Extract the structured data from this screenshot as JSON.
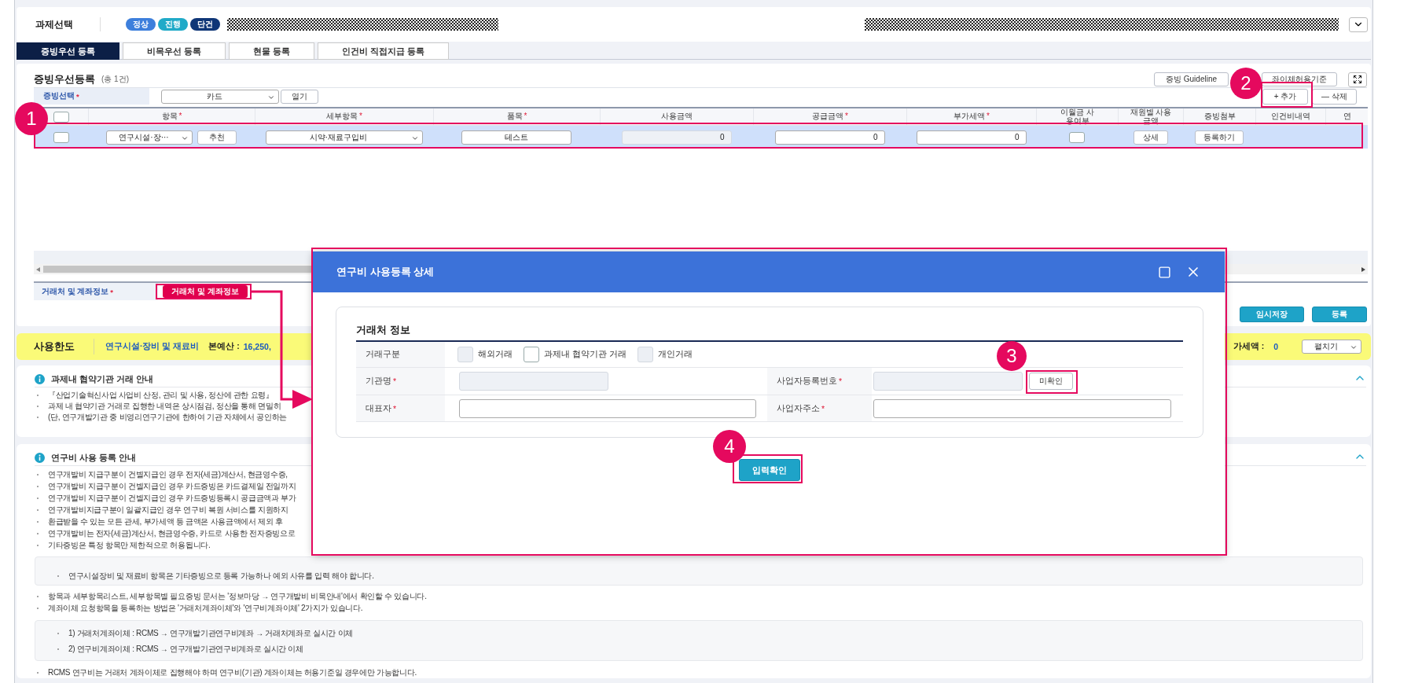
{
  "top_bar": {
    "title": "과제선택",
    "badges": [
      {
        "label": "정상",
        "color": "#3d7fdc"
      },
      {
        "label": "진행",
        "color": "#20aac8"
      },
      {
        "label": "단건",
        "color": "#0f3677"
      }
    ]
  },
  "tabs": [
    {
      "label": "증빙우선 등록",
      "selected": true
    },
    {
      "label": "비목우선 등록",
      "selected": false
    },
    {
      "label": "현물 등록",
      "selected": false
    },
    {
      "label": "인건비 직접지급 등록",
      "selected": false
    }
  ],
  "register": {
    "title": "증빙우선등록",
    "count": "(총 1건)",
    "guide_buttons": [
      "증빙 Guideline",
      "좌이체허용기준"
    ],
    "filter": {
      "label": "증빙선택",
      "mark": "*",
      "value": "카드",
      "button": "열기"
    },
    "row_buttons": [
      "+ 추가",
      "— 삭제"
    ],
    "header_checked": false,
    "columns": [
      {
        "label": "항목",
        "mark": "*"
      },
      {
        "label": "세부항목",
        "mark": "*"
      },
      {
        "label": "품목",
        "mark": "*"
      },
      {
        "label": "사용금액"
      },
      {
        "label": "공급금액",
        "mark": "*"
      },
      {
        "label": "부가세액",
        "mark": "*"
      },
      {
        "label": "이월금 사용여부"
      },
      {
        "label": "재원별 사용금액"
      },
      {
        "label": "증빙첨부"
      },
      {
        "label": "인건비내역"
      },
      {
        "label": "연"
      }
    ],
    "rows": [
      {
        "selected": true,
        "checked": false,
        "item": "연구시설·장···",
        "recommend": "추천",
        "sub_item": "시약·재료구입비",
        "product": {
          "value": "테스트",
          "disabled": false
        },
        "usage_amount": {
          "value": "0",
          "disabled": true
        },
        "supply_amount": {
          "value": "0",
          "disabled": false
        },
        "vat": {
          "value": "0",
          "disabled": false
        },
        "carryover_checked": false,
        "detail": "상세",
        "attach": "등록하기"
      }
    ],
    "footer": {
      "label": "거래처 및 계좌정보",
      "mark": "*",
      "button": "거래처 및 계좌정보"
    },
    "actions": [
      "임시저장",
      "등록"
    ]
  },
  "limit_bar": {
    "title": "사용한도",
    "category": "연구시설·장비 및 재료비",
    "budget_label": "본예산 :",
    "budget_value": "16,250,",
    "vat_label": "가세액 :",
    "vat_value": "0",
    "toggle": "펼치기"
  },
  "notices": [
    {
      "title": "과제내 협약기관 거래 안내",
      "expanded": true,
      "blocks": [
        {
          "kind": "bullet",
          "text": "『산업기술혁신사업 사업비 산정, 관리 및 사용, 정산에 관한 요령』"
        },
        {
          "kind": "bullet",
          "text": "과제 내 협약기관 거래로 집행한 내역은 상시점검, 정산을 통해 면밀히"
        },
        {
          "kind": "bullet",
          "text": "(단, 연구개발기관 중 비영리연구기관에 한하여 기관 자체에서 공인하는"
        }
      ]
    },
    {
      "title": "연구비 사용 등록 안내",
      "expanded": true,
      "blocks": [
        {
          "kind": "bullet",
          "text": "연구개발비 지급구분이 건별지급인 경우 전자(세금)계산서, 현금영수증,"
        },
        {
          "kind": "bullet",
          "text": "연구개발비 지급구분이 건별지급인 경우 카드증빙은 카드결제일 전일까지"
        },
        {
          "kind": "bullet",
          "text": "연구개발비 지급구분이 건별지급인 경우 카드증빙등록시 공급금액과 부가"
        },
        {
          "kind": "bullet",
          "text": "연구개발비지급구분이 일괄지급인 경우 연구비 복원 서비스를 지원하지"
        },
        {
          "kind": "bullet",
          "text": "환급받을 수 있는 모든 관세, 부가세액 등 금액은 사용금액에서 제외 후"
        },
        {
          "kind": "bullet",
          "text": "연구개발비는 전자(세금)계산서, 현금영수증, 카드로 사용한 전자증빙으로"
        },
        {
          "kind": "bullet",
          "text": "기타증빙은 특정 항목만 제한적으로 허용됩니다."
        },
        {
          "kind": "box",
          "items": [
            "연구시설장비 및 재료비 항목은 기타증빙으로 등록 가능하나 예외 사유를 입력 해야 합니다."
          ]
        },
        {
          "kind": "bullet",
          "text": "항목과 세부항목리스트, 세부항목별 필요증빙 문서는 '정보마당 → 연구개발비 비목안내'에서 확인할 수 있습니다."
        },
        {
          "kind": "bullet",
          "text": "계좌이체 요청항목을 등록하는 방법은 '거래처계좌이체'와 '연구비계좌이체' 2가지가 있습니다."
        },
        {
          "kind": "box",
          "items": [
            "1) 거래처계좌이체 : RCMS → 연구개발기관연구비계좌 → 거래처계좌로 실시간 이체",
            "2) 연구비계좌이체 : RCMS → 연구개발기관연구비계좌로 실시간 이체"
          ]
        },
        {
          "kind": "bullet",
          "text": "RCMS 연구비는 거래처 계좌이체로 집행해야 하며 연구비(기관) 계좌이체는 허용기준일 경우에만 가능합니다."
        }
      ]
    }
  ],
  "dialog": {
    "title": "연구비 사용등록 상세",
    "section": "거래처 정보",
    "trade_type": {
      "label": "거래구분",
      "options": [
        {
          "label": "해외거래",
          "checked": false,
          "disabled": true
        },
        {
          "label": "과제내 협약기관 거래",
          "checked": false,
          "disabled": false
        },
        {
          "label": "개인거래",
          "checked": false,
          "disabled": true
        }
      ]
    },
    "fields": [
      {
        "label": "기관명",
        "mark": "*",
        "disabled": true
      },
      {
        "label": "사업자등록번호",
        "mark": "*",
        "disabled": true,
        "button": "미확인"
      },
      {
        "label": "대표자",
        "mark": "*",
        "disabled": false
      },
      {
        "label": "사업자주소",
        "mark": "*",
        "disabled": false
      }
    ],
    "confirm": "입력확인"
  },
  "annotations": [
    "1",
    "2",
    "3",
    "4"
  ]
}
